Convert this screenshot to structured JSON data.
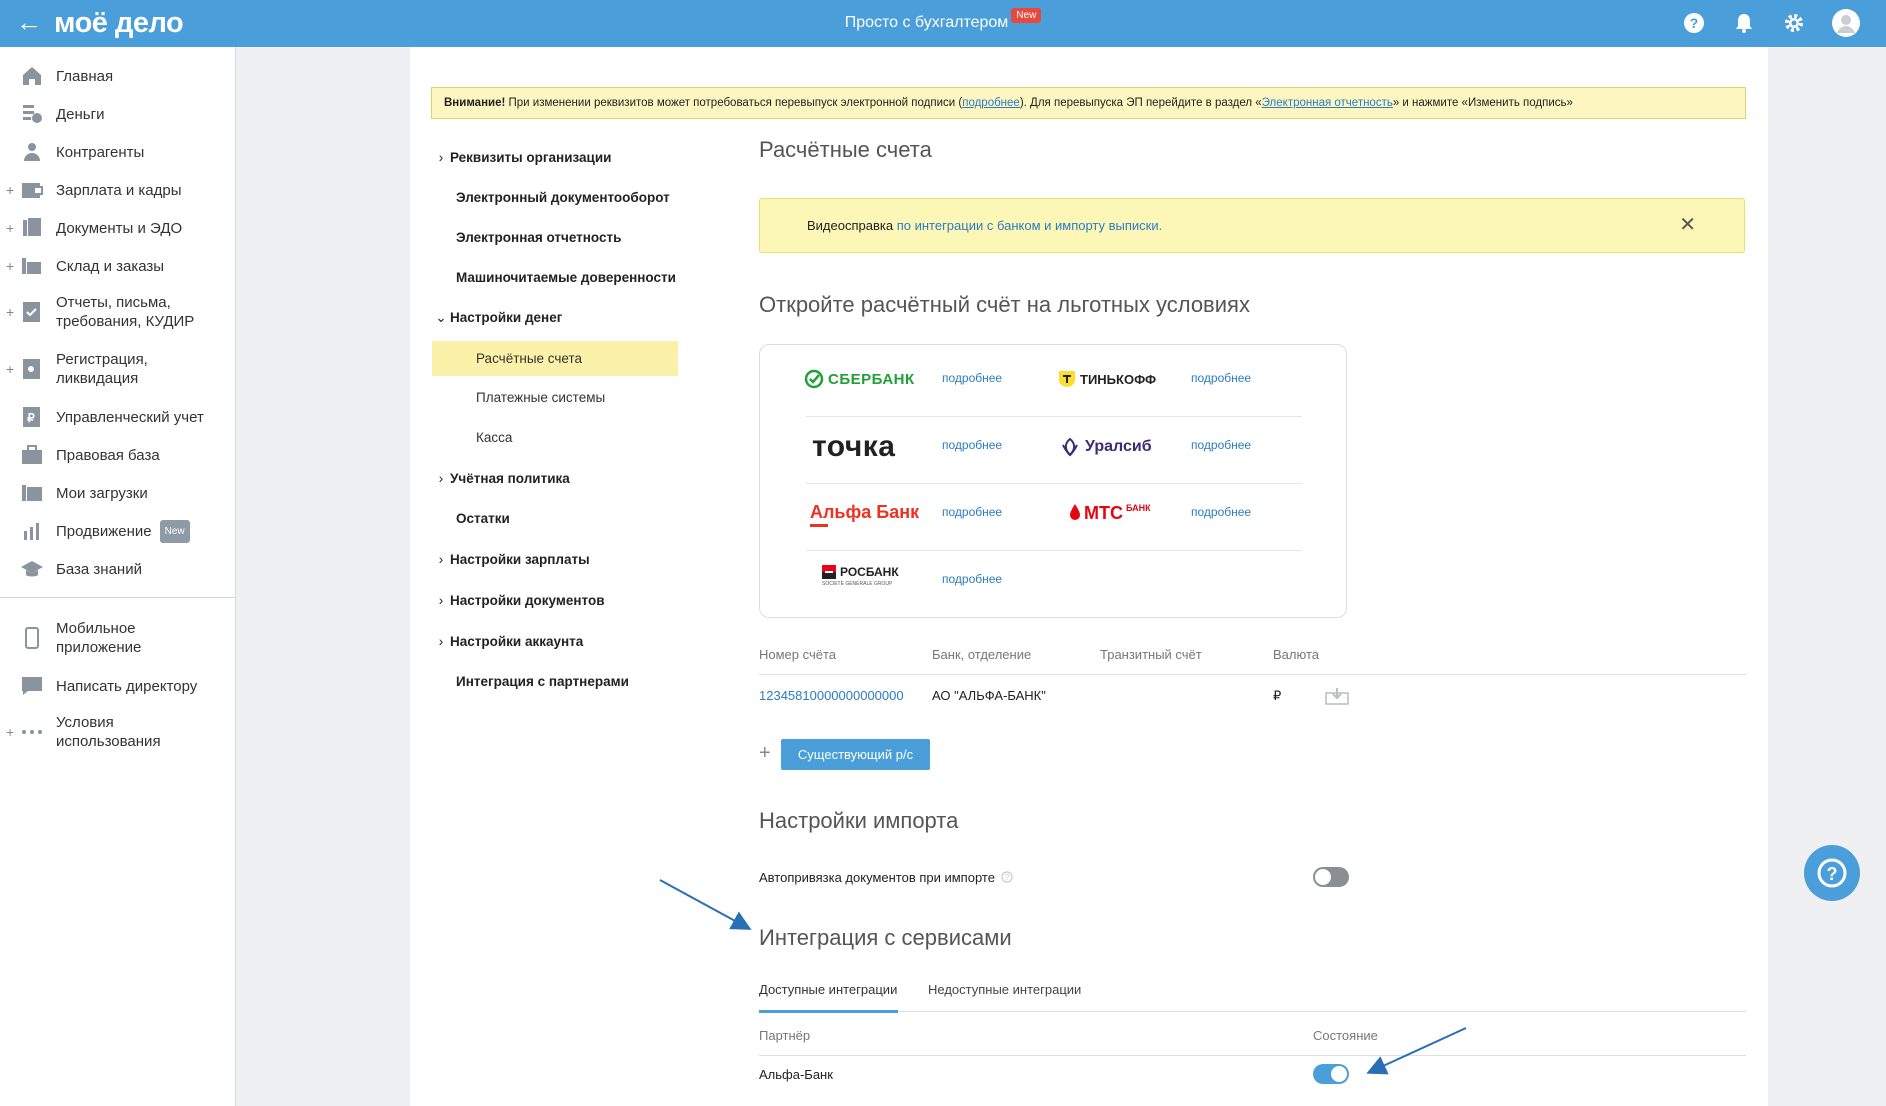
{
  "topbar": {
    "back_icon": "arrow-left-icon",
    "logo": "моё дело",
    "title": "Просто с бухгалтером",
    "title_badge": "New",
    "icons": [
      "help-icon",
      "bell-icon",
      "gear-icon",
      "user-avatar-icon"
    ]
  },
  "sidebar": {
    "items": [
      {
        "label": "Главная",
        "icon": "home-icon",
        "expandable": false
      },
      {
        "label": "Деньги",
        "icon": "money-icon",
        "expandable": false
      },
      {
        "label": "Контрагенты",
        "icon": "contractors-icon",
        "expandable": false
      },
      {
        "label": "Зарплата и кадры",
        "icon": "salary-icon",
        "expandable": true
      },
      {
        "label": "Документы и ЭДО",
        "icon": "documents-icon",
        "expandable": true
      },
      {
        "label": "Склад и заказы",
        "icon": "warehouse-icon",
        "expandable": true
      },
      {
        "label": "Отчеты, письма, требования, КУДИР",
        "icon": "reports-icon",
        "expandable": true
      },
      {
        "label": "Регистрация, ликвидация",
        "icon": "registration-icon",
        "expandable": true
      },
      {
        "label": "Управленческий учет",
        "icon": "management-icon",
        "expandable": false
      },
      {
        "label": "Правовая база",
        "icon": "briefcase-icon",
        "expandable": false
      },
      {
        "label": "Мои загрузки",
        "icon": "folder-icon",
        "expandable": false
      },
      {
        "label": "Продвижение",
        "icon": "chart-icon",
        "expandable": false,
        "badge": "New"
      },
      {
        "label": "База знаний",
        "icon": "graduation-cap-icon",
        "expandable": false
      }
    ],
    "bottom_items": [
      {
        "label": "Мобильное приложение",
        "icon": "mobile-icon",
        "expandable": false
      },
      {
        "label": "Написать директору",
        "icon": "chat-icon",
        "expandable": false
      },
      {
        "label": "Условия использования",
        "icon": "more-dots-icon",
        "expandable": true
      }
    ]
  },
  "warning": {
    "strong": "Внимание!",
    "text1": " При изменении реквизитов может потребоваться перевыпуск электронной подписи (",
    "link1": "подробнее",
    "text2": "). Для перевыпуска ЭП перейдите в раздел «",
    "link2": "Электронная отчетность",
    "text3": "» и нажмите «Изменить подпись»"
  },
  "settings_nav": [
    {
      "label": "Реквизиты организации",
      "chevron": "right"
    },
    {
      "label": "Электронный документооборот"
    },
    {
      "label": "Электронная отчетность"
    },
    {
      "label": "Машиночитаемые доверенности"
    },
    {
      "label": "Настройки денег",
      "chevron": "down"
    },
    {
      "label": "Расчётные счета",
      "sub": true,
      "active": true
    },
    {
      "label": "Платежные системы",
      "sub": true
    },
    {
      "label": "Касса",
      "sub": true
    },
    {
      "label": "Учётная политика",
      "chevron": "right"
    },
    {
      "label": "Остатки"
    },
    {
      "label": "Настройки зарплаты",
      "chevron": "right"
    },
    {
      "label": "Настройки документов",
      "chevron": "right"
    },
    {
      "label": "Настройки аккаунта",
      "chevron": "right"
    },
    {
      "label": "Интеграция с партнерами"
    }
  ],
  "content": {
    "title": "Расчётные счета",
    "video": {
      "prefix": "Видеосправка ",
      "link": "по интеграции с банком и импорту выписки."
    },
    "promo_title": "Откройте расчётный счёт на льготных условиях",
    "banks": [
      {
        "name": "СБЕРБАНК",
        "more": "подробнее",
        "color": "#21a038"
      },
      {
        "name": "ТИНЬКОФФ",
        "more": "подробнее",
        "color": "#222222"
      },
      {
        "name": "точка",
        "more": "подробнее",
        "color": "#222222"
      },
      {
        "name": "Уралсиб",
        "more": "подробнее",
        "color": "#3b2a7a"
      },
      {
        "name": "Альфа Банк",
        "more": "подробнее",
        "color": "#ef3124"
      },
      {
        "name": "МТС",
        "sub": "БАНК",
        "more": "подробнее",
        "color": "#e30611"
      },
      {
        "name": "РОСБАНК",
        "sub": "SOCIETE GENERALE GROUP",
        "more": "подробнее",
        "color": "#222222"
      }
    ],
    "accounts_table": {
      "headers": [
        "Номер счёта",
        "Банк, отделение",
        "Транзитный счёт",
        "Валюта"
      ],
      "rows": [
        {
          "number": "12345810000000000000",
          "bank": "АО \"АЛЬФА-БАНК\"",
          "transit": "",
          "currency": "₽"
        }
      ]
    },
    "add_plus": "+",
    "add_button": "Существующий р/с",
    "import_title": "Настройки импорта",
    "autolink_label": "Автопривязка документов при импорте",
    "autolink_on": false,
    "integration_title": "Интеграция с сервисами",
    "tabs": [
      "Доступные интеграции",
      "Недоступные интеграции"
    ],
    "integration_headers": [
      "Партнёр",
      "Состояние"
    ],
    "integrations": [
      {
        "partner": "Альфа-Банк",
        "enabled": true
      }
    ]
  },
  "colors": {
    "brand": "#4a9ed9",
    "highlight": "#fbf1a9",
    "warning_bg": "#fdf6c1",
    "annotation_arrow": "#2a6fb5"
  }
}
